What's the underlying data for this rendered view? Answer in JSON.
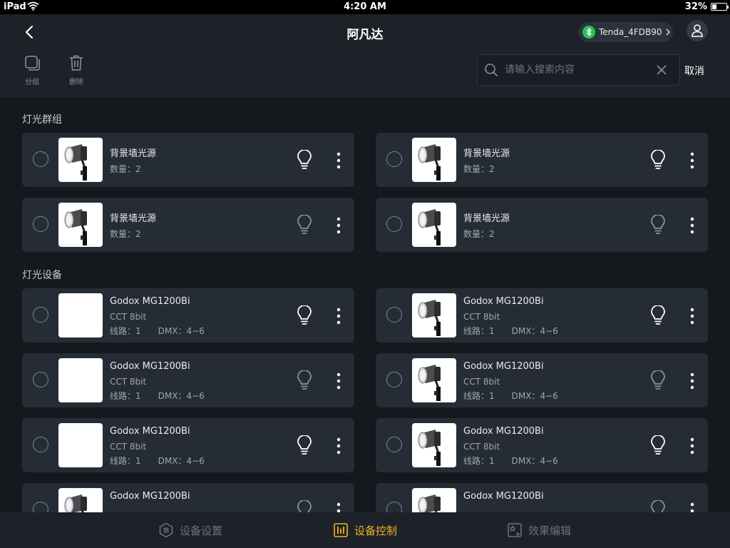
{
  "status_bar": {
    "carrier": "iPad",
    "time": "4:20 AM",
    "battery": "32%",
    "battery_level": 0.32
  },
  "header": {
    "title": "阿凡达",
    "network_name": "Tenda_4FDB90",
    "tools": {
      "group_label": "分组",
      "delete_label": "删除"
    },
    "search": {
      "placeholder": "请输入搜索内容",
      "value": ""
    },
    "cancel_label": "取消"
  },
  "groups_section": {
    "title": "灯光群组",
    "items": [
      {
        "name": "背景墙光源",
        "count": "数量：2",
        "bulb_on": true
      },
      {
        "name": "背景墙光源",
        "count": "数量：2",
        "bulb_on": true
      },
      {
        "name": "背景墙光源",
        "count": "数量：2",
        "bulb_on": false
      },
      {
        "name": "背景墙光源",
        "count": "数量：2",
        "bulb_on": false
      }
    ]
  },
  "devices_section": {
    "title": "灯光设备",
    "items": [
      {
        "name": "Godox MG1200Bi",
        "mode": "CCT 8bit",
        "line": "线路：1",
        "dmx": "DMX：4−6",
        "bulb_on": true,
        "has_image": false
      },
      {
        "name": "Godox MG1200Bi",
        "mode": "CCT 8bit",
        "line": "线路：1",
        "dmx": "DMX：4−6",
        "bulb_on": true,
        "has_image": true
      },
      {
        "name": "Godox MG1200Bi",
        "mode": "CCT 8bit",
        "line": "线路：1",
        "dmx": "DMX：4−6",
        "bulb_on": false,
        "has_image": false
      },
      {
        "name": "Godox MG1200Bi",
        "mode": "CCT 8bit",
        "line": "线路：1",
        "dmx": "DMX：4−6",
        "bulb_on": false,
        "has_image": true
      },
      {
        "name": "Godox MG1200Bi",
        "mode": "CCT 8bit",
        "line": "线路：1",
        "dmx": "DMX：4−6",
        "bulb_on": true,
        "has_image": false
      },
      {
        "name": "Godox MG1200Bi",
        "mode": "CCT 8bit",
        "line": "线路：1",
        "dmx": "DMX：4−6",
        "bulb_on": true,
        "has_image": true
      },
      {
        "name": "Godox MG1200Bi",
        "bulb_on": false,
        "has_image": true
      },
      {
        "name": "Godox MG1200Bi",
        "bulb_on": false,
        "has_image": true
      }
    ]
  },
  "tabbar": {
    "tabs": [
      {
        "label": "设备设置",
        "icon": "settings-hexagon-icon",
        "active": false
      },
      {
        "label": "设备控制",
        "icon": "control-sliders-icon",
        "active": true
      },
      {
        "label": "效果编辑",
        "icon": "effect-edit-icon",
        "active": false
      }
    ]
  },
  "colors": {
    "accent": "#f0b323",
    "background": "#15181d",
    "card": "#262c35",
    "header": "#1d2229",
    "bluetooth": "#29c256"
  }
}
